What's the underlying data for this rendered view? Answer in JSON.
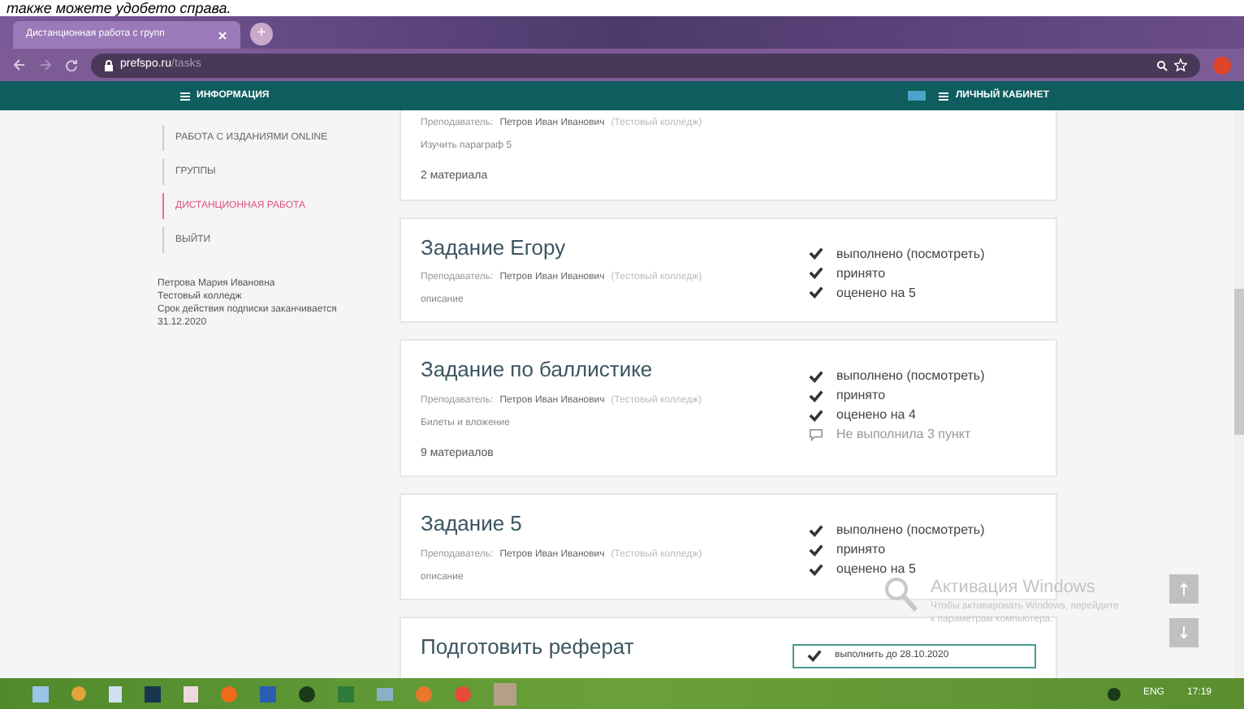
{
  "caption": "также можете удобето справа.",
  "browser": {
    "tab_title": "Дистанционная работа с групп",
    "new_tab": "+",
    "url_host": "prefspo.ru",
    "url_path": "/tasks"
  },
  "nav": {
    "left": "ИНФОРМАЦИЯ",
    "right": "ЛИЧНЫЙ КАБИНЕТ"
  },
  "sidebar": {
    "items": [
      {
        "label": "РАБОТА С ИЗДАНИЯМИ ONLINE",
        "selected": false
      },
      {
        "label": "ГРУППЫ",
        "selected": false
      },
      {
        "label": "ДИСТАНЦИОННАЯ РАБОТА",
        "selected": true
      },
      {
        "label": "ВЫЙТИ",
        "selected": false
      }
    ],
    "user": [
      "Петрова Мария Ивановна",
      "Тестовый колледж",
      "Срок действия подписки заканчивается",
      "31.12.2020"
    ]
  },
  "tasks": [
    {
      "teacher_label": "Преподаватель:",
      "teacher": "Петров Иван Иванович",
      "college": "(Тестовый колледж)",
      "description": "Изучить параграф 5",
      "materials": "2 материала"
    },
    {
      "title": "Задание Егору",
      "teacher_label": "Преподаватель:",
      "teacher": "Петров Иван Иванович",
      "college": "(Тестовый колледж)",
      "description": "описание",
      "statuses": [
        {
          "kind": "check",
          "text": "выполнено (посмотреть)"
        },
        {
          "kind": "check",
          "text": "принято"
        },
        {
          "kind": "check",
          "text": "оценено на 5"
        }
      ]
    },
    {
      "title": "Задание по баллистике",
      "teacher_label": "Преподаватель:",
      "teacher": "Петров Иван Иванович",
      "college": "(Тестовый колледж)",
      "description": "Билеты и вложение",
      "materials": "9 материалов",
      "statuses": [
        {
          "kind": "check",
          "text": "выполнено (посмотреть)"
        },
        {
          "kind": "check",
          "text": "принято"
        },
        {
          "kind": "check",
          "text": "оценено на 4"
        },
        {
          "kind": "comment",
          "text": "Не выполнила 3 пункт"
        }
      ]
    },
    {
      "title": "Задание 5",
      "teacher_label": "Преподаватель:",
      "teacher": "Петров Иван Иванович",
      "college": "(Тестовый колледж)",
      "description": "описание",
      "statuses": [
        {
          "kind": "check",
          "text": "выполнено (посмотреть)"
        },
        {
          "kind": "check",
          "text": "принято"
        },
        {
          "kind": "check",
          "text": "оценено на 5"
        }
      ]
    },
    {
      "title": "Подготовить реферат",
      "deadline": "выполнить до 28.10.2020"
    }
  ],
  "activation": {
    "title": "Активация Windows",
    "text": "Чтобы активировать Windows, перейдите к параметрам компьютера."
  },
  "taskbar": {
    "lang": "ENG",
    "time": "17:19"
  }
}
